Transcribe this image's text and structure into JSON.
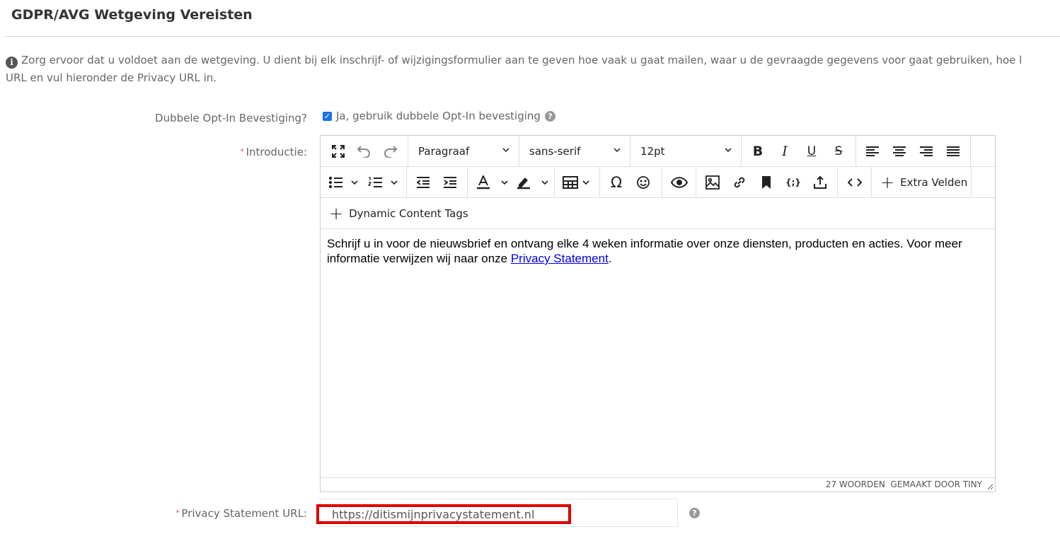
{
  "section": {
    "title": "GDPR/AVG Wetgeving Vereisten"
  },
  "info": {
    "line1": "Zorg ervoor dat u voldoet aan de wetgeving. U dient bij elk inschrijf- of wijzigingsformulier aan te geven hoe vaak u gaat mailen, waar u de gevraagde gegevens voor gaat gebruiken, hoe l",
    "line2": "URL en vul hieronder de Privacy URL in."
  },
  "optin": {
    "label": "Dubbele Opt-In Bevestiging?",
    "checkbox_label": "Ja, gebruik dubbele Opt-In bevestiging",
    "checked": true
  },
  "intro": {
    "label": "Introductie:",
    "toolbar": {
      "block_format": "Paragraaf",
      "font_family": "sans-serif",
      "font_size": "12pt",
      "extra_fields": "Extra Velden",
      "dynamic_tags": "Dynamic Content Tags"
    },
    "content": {
      "text": "Schrijf u in voor de nieuwsbrief en ontvang elke 4 weken informatie over onze diensten, producten en acties. Voor meer informatie verwijzen wij naar onze ",
      "link": "Privacy Statement",
      "end": "."
    },
    "status": {
      "words": "27 WOORDEN",
      "branding": "GEMAAKT DOOR TINY"
    }
  },
  "privacy": {
    "label": "Privacy Statement URL:",
    "value": "https://ditismijnprivacystatement.nl"
  },
  "colors": {
    "highlight": "#e00000",
    "checkbox": "#1a73e8",
    "link": "#0000ee"
  }
}
